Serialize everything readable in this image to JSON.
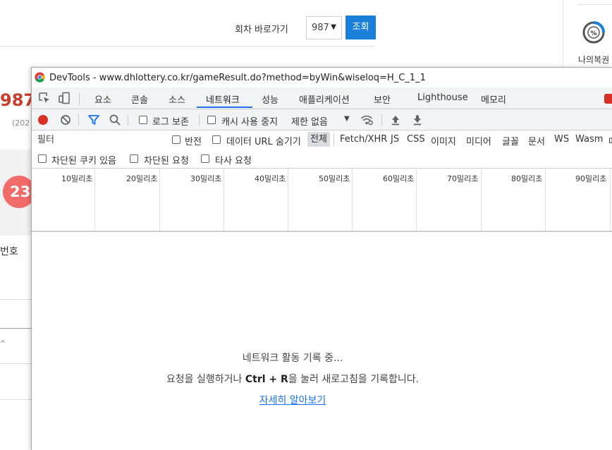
{
  "background_page": {
    "round_label": "회차 바로가기",
    "round_value": "987",
    "round_button": "조회",
    "my_lotto_label": "나의복권",
    "draw_number_partial": "987",
    "date_partial": "(202",
    "ball_partial": "23",
    "bonus_partial": "번호",
    "caret": "^"
  },
  "devtools": {
    "title": "DevTools - www.dhlottery.co.kr/gameResult.do?method=byWin&wiseloq=H_C_1_1",
    "tabs": [
      {
        "label": "요소"
      },
      {
        "label": "콘솔"
      },
      {
        "label": "소스"
      },
      {
        "label": "네트워크"
      },
      {
        "label": "성능"
      },
      {
        "label": "애플리케이션"
      },
      {
        "label": "보안"
      },
      {
        "label": "Lighthouse"
      },
      {
        "label": "메모리"
      }
    ],
    "active_tab": "네트워크",
    "toolbar": {
      "preserve_log": "로그 보존",
      "disable_cache": "캐시 사용 중지",
      "throttling": "제한 없음"
    },
    "filter": {
      "placeholder": "필터",
      "invert": "반전",
      "hide_data_urls": "데이터 URL 숨기기",
      "types": [
        "전체",
        "Fetch/XHR",
        "JS",
        "CSS",
        "이미지",
        "미디어",
        "글꼴",
        "문서",
        "WS",
        "Wasm",
        "매"
      ],
      "selected_type": "전체",
      "blocked_cookies": "차단된 쿠키 있음",
      "blocked_requests": "차단된 요청",
      "third_party": "타사 요청"
    },
    "timeline_ticks": [
      "10밀리초",
      "20밀리초",
      "30밀리초",
      "40밀리초",
      "50밀리초",
      "60밀리초",
      "70밀리초",
      "80밀리초",
      "90밀리초"
    ],
    "empty_state": {
      "title": "네트워크 활동 기록 중...",
      "hint_before": "요청을 실행하거나 ",
      "hint_shortcut": "Ctrl + R",
      "hint_after": "을 눌러 새로고침을 기록합니다.",
      "learn_more": "자세히 알아보기"
    },
    "colors": {
      "record_red": "#d93025",
      "accent_blue": "#1a73e8",
      "toolbar_bg": "#f1f3f4"
    }
  }
}
